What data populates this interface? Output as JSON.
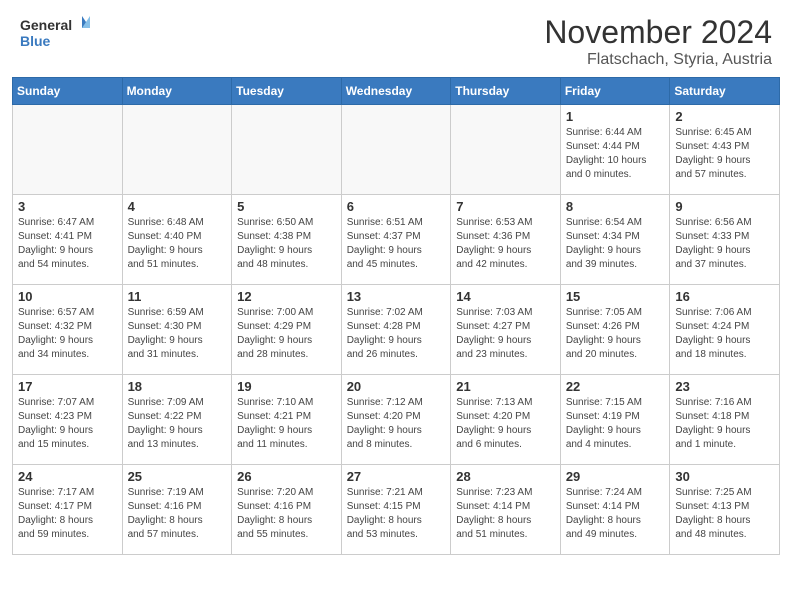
{
  "header": {
    "logo_line1": "General",
    "logo_line2": "Blue",
    "month": "November 2024",
    "location": "Flatschach, Styria, Austria"
  },
  "weekdays": [
    "Sunday",
    "Monday",
    "Tuesday",
    "Wednesday",
    "Thursday",
    "Friday",
    "Saturday"
  ],
  "weeks": [
    [
      {
        "day": "",
        "info": ""
      },
      {
        "day": "",
        "info": ""
      },
      {
        "day": "",
        "info": ""
      },
      {
        "day": "",
        "info": ""
      },
      {
        "day": "",
        "info": ""
      },
      {
        "day": "1",
        "info": "Sunrise: 6:44 AM\nSunset: 4:44 PM\nDaylight: 10 hours\nand 0 minutes."
      },
      {
        "day": "2",
        "info": "Sunrise: 6:45 AM\nSunset: 4:43 PM\nDaylight: 9 hours\nand 57 minutes."
      }
    ],
    [
      {
        "day": "3",
        "info": "Sunrise: 6:47 AM\nSunset: 4:41 PM\nDaylight: 9 hours\nand 54 minutes."
      },
      {
        "day": "4",
        "info": "Sunrise: 6:48 AM\nSunset: 4:40 PM\nDaylight: 9 hours\nand 51 minutes."
      },
      {
        "day": "5",
        "info": "Sunrise: 6:50 AM\nSunset: 4:38 PM\nDaylight: 9 hours\nand 48 minutes."
      },
      {
        "day": "6",
        "info": "Sunrise: 6:51 AM\nSunset: 4:37 PM\nDaylight: 9 hours\nand 45 minutes."
      },
      {
        "day": "7",
        "info": "Sunrise: 6:53 AM\nSunset: 4:36 PM\nDaylight: 9 hours\nand 42 minutes."
      },
      {
        "day": "8",
        "info": "Sunrise: 6:54 AM\nSunset: 4:34 PM\nDaylight: 9 hours\nand 39 minutes."
      },
      {
        "day": "9",
        "info": "Sunrise: 6:56 AM\nSunset: 4:33 PM\nDaylight: 9 hours\nand 37 minutes."
      }
    ],
    [
      {
        "day": "10",
        "info": "Sunrise: 6:57 AM\nSunset: 4:32 PM\nDaylight: 9 hours\nand 34 minutes."
      },
      {
        "day": "11",
        "info": "Sunrise: 6:59 AM\nSunset: 4:30 PM\nDaylight: 9 hours\nand 31 minutes."
      },
      {
        "day": "12",
        "info": "Sunrise: 7:00 AM\nSunset: 4:29 PM\nDaylight: 9 hours\nand 28 minutes."
      },
      {
        "day": "13",
        "info": "Sunrise: 7:02 AM\nSunset: 4:28 PM\nDaylight: 9 hours\nand 26 minutes."
      },
      {
        "day": "14",
        "info": "Sunrise: 7:03 AM\nSunset: 4:27 PM\nDaylight: 9 hours\nand 23 minutes."
      },
      {
        "day": "15",
        "info": "Sunrise: 7:05 AM\nSunset: 4:26 PM\nDaylight: 9 hours\nand 20 minutes."
      },
      {
        "day": "16",
        "info": "Sunrise: 7:06 AM\nSunset: 4:24 PM\nDaylight: 9 hours\nand 18 minutes."
      }
    ],
    [
      {
        "day": "17",
        "info": "Sunrise: 7:07 AM\nSunset: 4:23 PM\nDaylight: 9 hours\nand 15 minutes."
      },
      {
        "day": "18",
        "info": "Sunrise: 7:09 AM\nSunset: 4:22 PM\nDaylight: 9 hours\nand 13 minutes."
      },
      {
        "day": "19",
        "info": "Sunrise: 7:10 AM\nSunset: 4:21 PM\nDaylight: 9 hours\nand 11 minutes."
      },
      {
        "day": "20",
        "info": "Sunrise: 7:12 AM\nSunset: 4:20 PM\nDaylight: 9 hours\nand 8 minutes."
      },
      {
        "day": "21",
        "info": "Sunrise: 7:13 AM\nSunset: 4:20 PM\nDaylight: 9 hours\nand 6 minutes."
      },
      {
        "day": "22",
        "info": "Sunrise: 7:15 AM\nSunset: 4:19 PM\nDaylight: 9 hours\nand 4 minutes."
      },
      {
        "day": "23",
        "info": "Sunrise: 7:16 AM\nSunset: 4:18 PM\nDaylight: 9 hours\nand 1 minute."
      }
    ],
    [
      {
        "day": "24",
        "info": "Sunrise: 7:17 AM\nSunset: 4:17 PM\nDaylight: 8 hours\nand 59 minutes."
      },
      {
        "day": "25",
        "info": "Sunrise: 7:19 AM\nSunset: 4:16 PM\nDaylight: 8 hours\nand 57 minutes."
      },
      {
        "day": "26",
        "info": "Sunrise: 7:20 AM\nSunset: 4:16 PM\nDaylight: 8 hours\nand 55 minutes."
      },
      {
        "day": "27",
        "info": "Sunrise: 7:21 AM\nSunset: 4:15 PM\nDaylight: 8 hours\nand 53 minutes."
      },
      {
        "day": "28",
        "info": "Sunrise: 7:23 AM\nSunset: 4:14 PM\nDaylight: 8 hours\nand 51 minutes."
      },
      {
        "day": "29",
        "info": "Sunrise: 7:24 AM\nSunset: 4:14 PM\nDaylight: 8 hours\nand 49 minutes."
      },
      {
        "day": "30",
        "info": "Sunrise: 7:25 AM\nSunset: 4:13 PM\nDaylight: 8 hours\nand 48 minutes."
      }
    ]
  ]
}
